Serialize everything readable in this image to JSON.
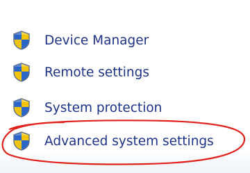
{
  "panel": {
    "task_links": [
      {
        "label": "Device Manager",
        "icon": "uac-shield-icon"
      },
      {
        "label": "Remote settings",
        "icon": "uac-shield-icon"
      },
      {
        "label": "System protection",
        "icon": "uac-shield-icon"
      },
      {
        "label": "Advanced system settings",
        "icon": "uac-shield-icon"
      }
    ]
  },
  "colors": {
    "link_text": "#1e3287",
    "annotation_circle": "#e0201a",
    "shield_blue": "#2a66c8",
    "shield_yellow": "#f2c40c"
  }
}
